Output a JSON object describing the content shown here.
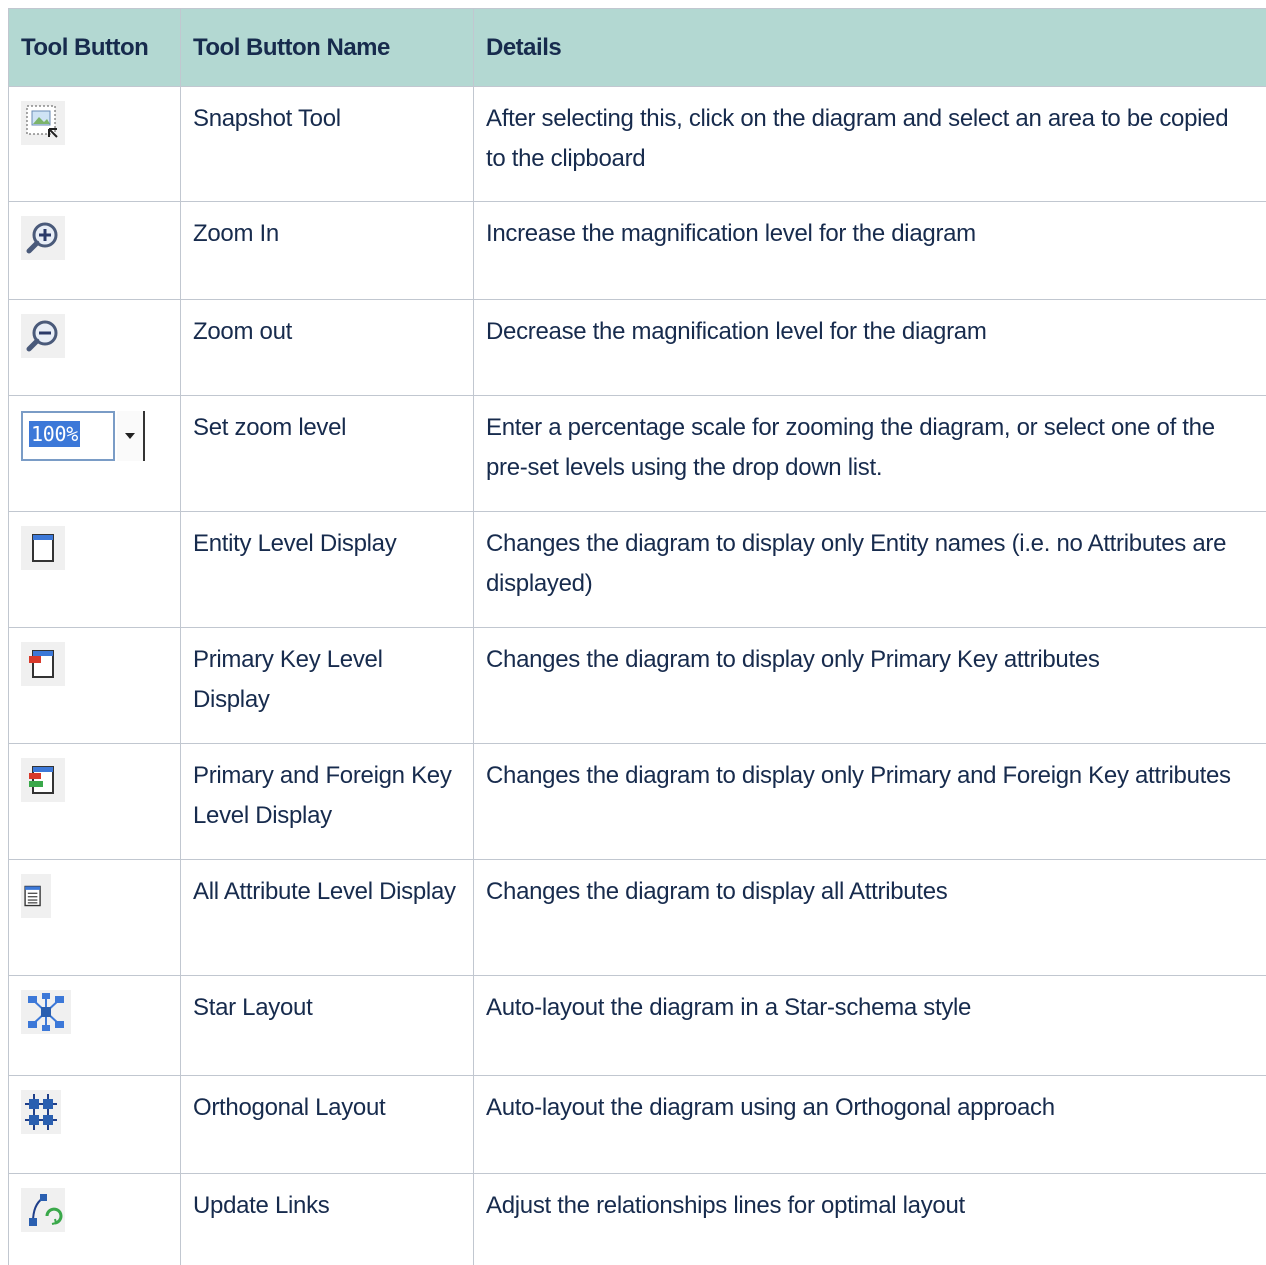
{
  "header": {
    "col1": "Tool Button",
    "col2": "Tool Button Name",
    "col3": "Details"
  },
  "rows": [
    {
      "icon": "snapshot-icon",
      "name": "Snapshot Tool",
      "details": "After selecting this, click on the diagram and select an area to be copied to the clipboard"
    },
    {
      "icon": "zoom-in-icon",
      "name": "Zoom In",
      "details": "Increase the magnification level for the diagram"
    },
    {
      "icon": "zoom-out-icon",
      "name": "Zoom out",
      "details": "Decrease the magnification level for the diagram"
    },
    {
      "icon": "zoom-level-select",
      "zoom_value": "100%",
      "name": "Set zoom level",
      "details": "Enter a percentage scale for zooming the diagram, or select one of the pre-set levels using the drop down list."
    },
    {
      "icon": "entity-level-icon",
      "name": "Entity Level Display",
      "details": "Changes the diagram to display only Entity names (i.e. no Attributes are displayed)"
    },
    {
      "icon": "primary-key-level-icon",
      "name": "Primary Key Level Display",
      "details": "Changes the diagram to display only Primary Key attributes"
    },
    {
      "icon": "primary-foreign-key-level-icon",
      "name": "Primary and Foreign Key Level Display",
      "details": "Changes the diagram to display only Primary and Foreign Key attributes"
    },
    {
      "icon": "all-attribute-level-icon",
      "name": "All Attribute Level Display",
      "details": "Changes the diagram to display all Attributes"
    },
    {
      "icon": "star-layout-icon",
      "name": "Star Layout",
      "details": "Auto-layout the diagram in a Star-schema style"
    },
    {
      "icon": "orthogonal-layout-icon",
      "name": "Orthogonal Layout",
      "details": "Auto-layout the diagram using an Orthogonal approach"
    },
    {
      "icon": "update-links-icon",
      "name": "Update Links",
      "details": "Adjust the relationships lines for optimal layout"
    }
  ]
}
